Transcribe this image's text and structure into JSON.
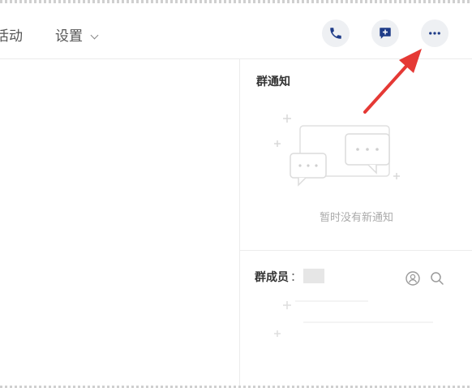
{
  "header": {
    "tabs": [
      {
        "label": "活动"
      },
      {
        "label": "设置"
      }
    ]
  },
  "notice": {
    "title": "群通知",
    "empty_text": "暂时没有新通知"
  },
  "members": {
    "title": "群成员",
    "count_prefix": "："
  },
  "icons": {
    "call": "phone-icon",
    "note": "message-add-icon",
    "more": "more-horizontal-icon",
    "add_member": "add-member-icon",
    "search": "search-icon"
  },
  "colors": {
    "icon_blue": "#1f3c88",
    "button_bg": "#eef0f3",
    "annotation_red": "#e53935",
    "divider": "#ececec"
  }
}
